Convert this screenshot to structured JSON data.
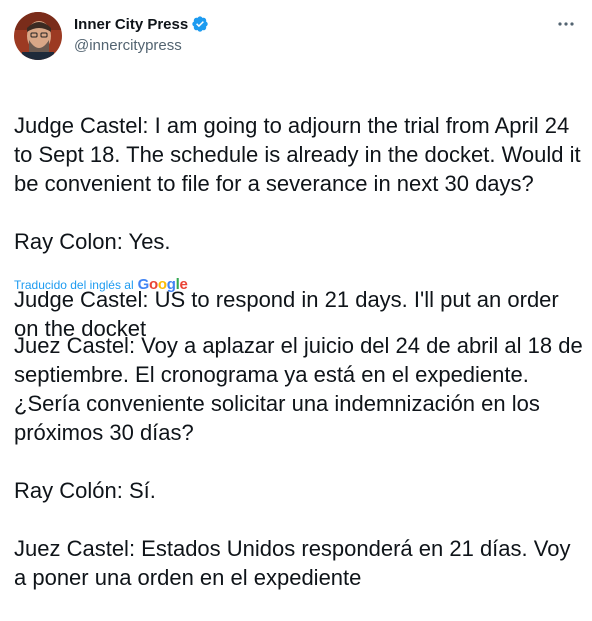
{
  "author": {
    "display_name": "Inner City Press",
    "handle": "@innercitypress",
    "verified": true
  },
  "icons": {
    "verified": "verified-badge-icon",
    "more": "more-options-icon"
  },
  "colors": {
    "accent": "#1d9bf0",
    "text": "#0f1419",
    "secondary": "#536471"
  },
  "tweet": {
    "original_lines": [
      "Judge Castel: I am going to adjourn the trial from April 24 to Sept 18. The schedule is already in the docket. Would it be convenient to file for a severance in next 30 days?",
      "Ray Colon: Yes.",
      "Judge Castel: US to respond in 21 days. I'll put an order on the docket"
    ],
    "translation_label": "Traducido del inglés al",
    "translation_provider": "Google",
    "translated_lines": [
      "Juez Castel: Voy a aplazar el juicio del 24 de abril al 18 de septiembre. El cronograma ya está en el expediente. ¿Sería conveniente solicitar una indemnización en los próximos 30 días?",
      "Ray Colón: Sí.",
      "Juez Castel: Estados Unidos responderá en 21 días. Voy a poner una orden en el expediente"
    ]
  }
}
